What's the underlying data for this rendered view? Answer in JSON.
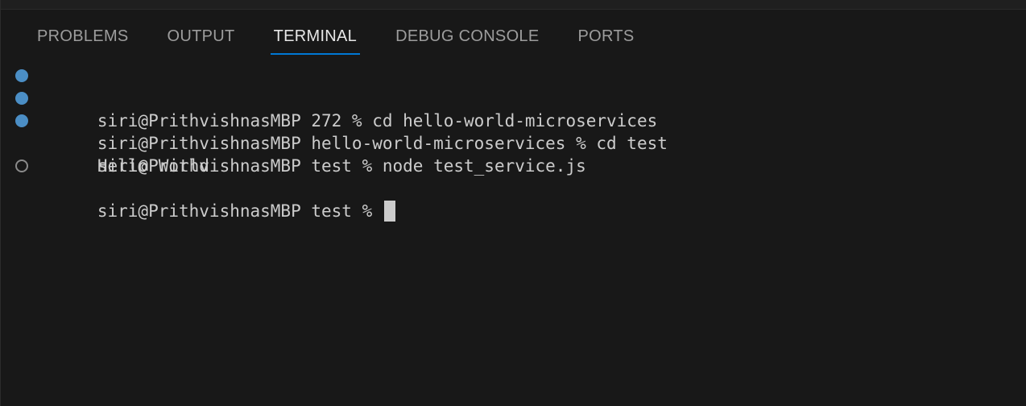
{
  "panel": {
    "tabs": [
      {
        "label": "PROBLEMS"
      },
      {
        "label": "OUTPUT"
      },
      {
        "label": "TERMINAL"
      },
      {
        "label": "DEBUG CONSOLE"
      },
      {
        "label": "PORTS"
      }
    ],
    "active_tab": "TERMINAL"
  },
  "terminal": {
    "lines": [
      {
        "text": "siri@PrithvishnasMBP 272 % cd hello-world-microservices",
        "decoration": "success-dot-icon"
      },
      {
        "text": "siri@PrithvishnasMBP hello-world-microservices % cd test",
        "decoration": "success-dot-icon"
      },
      {
        "text": "siri@PrithvishnasMBP test % node test_service.js",
        "decoration": "success-dot-icon"
      },
      {
        "text": "Hello World",
        "decoration": ""
      },
      {
        "text": "siri@PrithvishnasMBP test % ",
        "decoration": "pending-circle-icon"
      }
    ]
  },
  "colors": {
    "background": "#181818",
    "active_tab_underline": "#0078d4",
    "success_dot": "#4b8ec5"
  }
}
